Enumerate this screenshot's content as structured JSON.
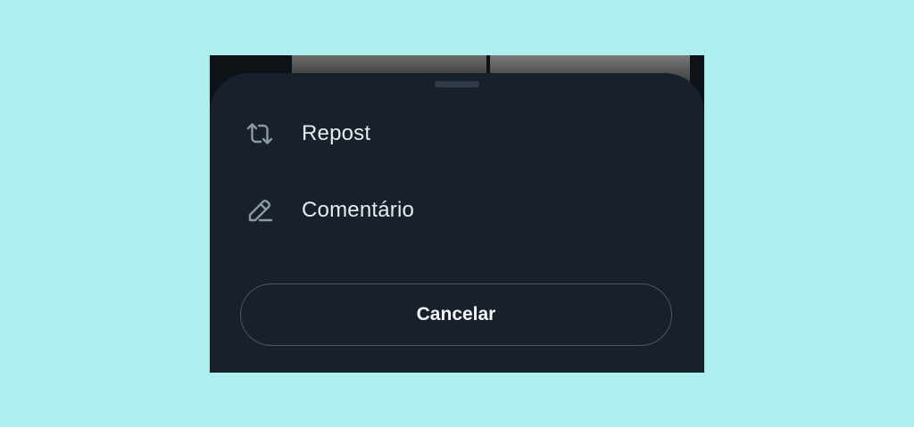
{
  "sheet": {
    "items": [
      {
        "label": "Repost",
        "icon": "repost-icon"
      },
      {
        "label": "Comentário",
        "icon": "pencil-icon"
      }
    ],
    "cancel_label": "Cancelar"
  },
  "colors": {
    "page_background": "#aeeeee",
    "sheet_background": "#18212b",
    "text": "#e7ebef",
    "icon": "#8b98a5"
  }
}
